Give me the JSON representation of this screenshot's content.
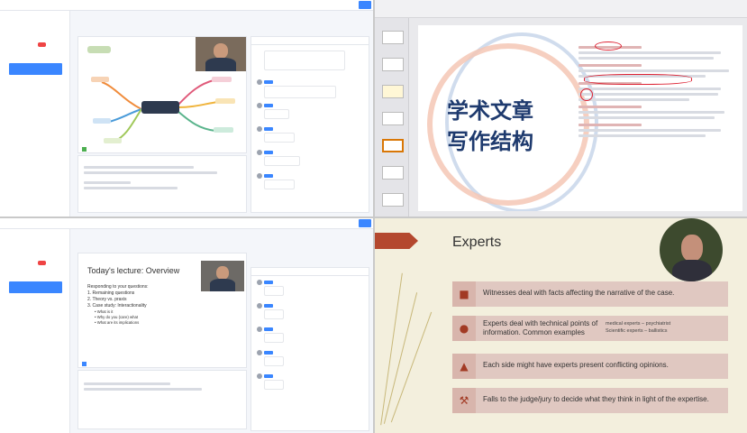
{
  "slides": {
    "cn_title_line1": "学术文章",
    "cn_title_line2": "写作结构",
    "experts_title": "Experts",
    "experts_items": [
      "Witnesses deal with facts affecting the narrative of the case.",
      "Experts deal with technical points of information. Common examples",
      "Each side might have experts present conflicting opinions.",
      "Falls to the judge/jury to decide what they think in light of the expertise."
    ],
    "experts_sub_1": "medical experts – psychiatrist",
    "experts_sub_2": "Scientific experts – ballistics",
    "overview_title": "Today's lecture: Overview",
    "overview_intro": "Responding to your questions:",
    "overview_points": [
      "1.  Remaining questions",
      "2.  Theory vs. praxis",
      "3.  Case study: Interactionality"
    ],
    "overview_sub": [
      "• What is it",
      "• Why do you (care) what",
      "• What are its implications"
    ]
  },
  "icons": {
    "expert_icons": [
      "briefcase-icon",
      "person-icon",
      "figure-icon",
      "gavel-icon"
    ],
    "chevron": "arrow-icon"
  },
  "colors": {
    "lms_accent": "#3a86ff",
    "slide_title": "#1e3a6e",
    "experts_band": "#e0c8c1",
    "experts_arrow": "#b4482e"
  }
}
